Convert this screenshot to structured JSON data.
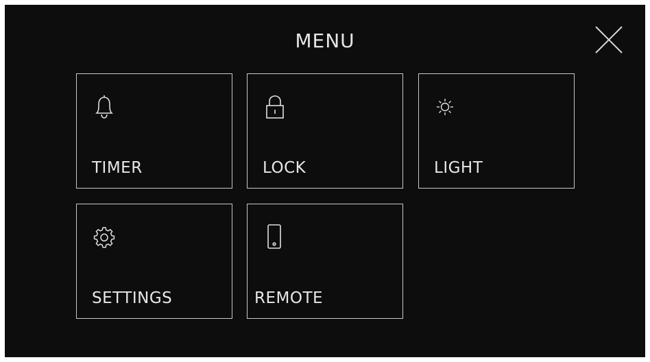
{
  "header": {
    "title": "MENU",
    "close_icon": "close-icon"
  },
  "tiles": [
    {
      "label": "TIMER",
      "icon": "bell-icon"
    },
    {
      "label": "LOCK",
      "icon": "lock-icon"
    },
    {
      "label": "LIGHT",
      "icon": "sun-icon"
    },
    {
      "label": "SETTINGS",
      "icon": "gear-icon"
    },
    {
      "label": "REMOTE",
      "icon": "phone-icon"
    }
  ],
  "colors": {
    "background": "#0d0d0d",
    "foreground": "#e8e8e8",
    "border": "#c9c9c9"
  }
}
